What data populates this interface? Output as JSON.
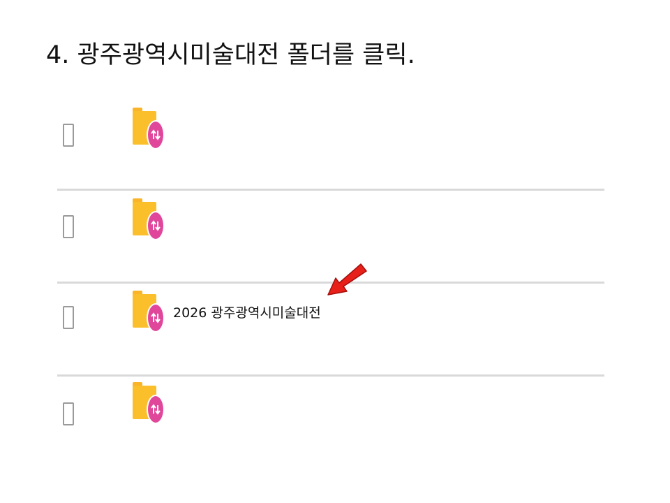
{
  "instruction": {
    "text": "4. 광주광역시미술대전 폴더를 클릭."
  },
  "file_list": {
    "rows": [
      {
        "label": "",
        "icon": "shared-folder-icon"
      },
      {
        "label": "",
        "icon": "shared-folder-icon"
      },
      {
        "label": "2026 광주광역시미술대전",
        "icon": "shared-folder-icon"
      },
      {
        "label": "",
        "icon": "shared-folder-icon"
      }
    ]
  },
  "colors": {
    "folder": "#fbbf2b",
    "badge": "#e0479b",
    "divider": "#d9d9d9",
    "arrow": "#e8201a"
  },
  "annotation": {
    "icon": "red-pointer-arrow-icon"
  }
}
